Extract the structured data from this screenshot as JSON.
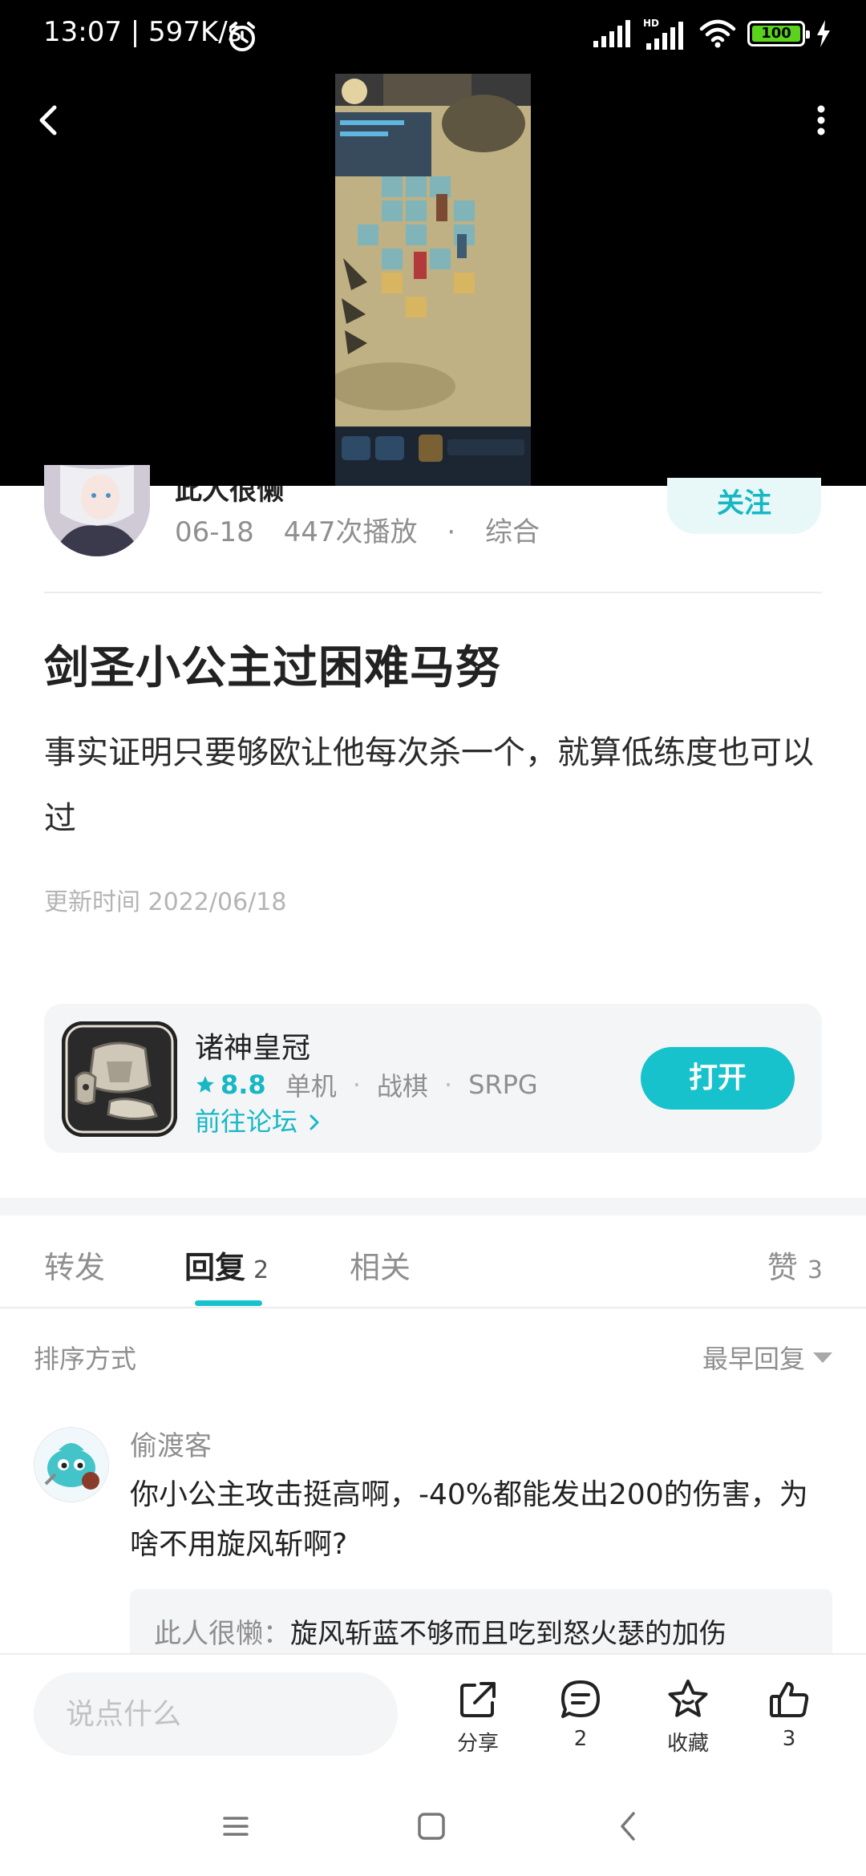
{
  "status_bar": {
    "time_speed": "13:07 | 597K/s",
    "battery": "100"
  },
  "author": {
    "name": "此人很懒",
    "date": "06-18",
    "plays": "447次播放",
    "separator": "·",
    "category": "综合",
    "follow_label": "关注"
  },
  "post": {
    "title": "剑圣小公主过困难马努",
    "body": "事实证明只要够欧让他每次杀一个，就算低练度也可以过",
    "updated": "更新时间 2022/06/18"
  },
  "game_card": {
    "name": "诸神皇冠",
    "rating": "8.8",
    "tags": [
      "单机",
      "战棋",
      "SRPG"
    ],
    "tag_separator": "·",
    "forum_link": "前往论坛",
    "open_label": "打开"
  },
  "tabs": {
    "forward": "转发",
    "reply": "回复",
    "reply_count": "2",
    "related": "相关",
    "likes": "赞",
    "likes_count": "3"
  },
  "sort": {
    "label": "排序方式",
    "selected": "最早回复"
  },
  "comment": {
    "user": "偷渡客",
    "text": "你小公主攻击挺高啊，-40%都能发出200的伤害，为啥不用旋风斩啊?",
    "reply_user": "此人很懒",
    "reply_colon": "：",
    "reply_text": "旋风斩蓝不够而且吃到怒火瑟的加伤"
  },
  "action_bar": {
    "input_placeholder": "说点什么",
    "share_label": "分享",
    "comment_count": "2",
    "favorite_label": "收藏",
    "like_count": "3"
  },
  "colors": {
    "accent": "#17c2cc",
    "follow_bg": "#e8f8f8",
    "battery_green": "#5bd31c"
  }
}
